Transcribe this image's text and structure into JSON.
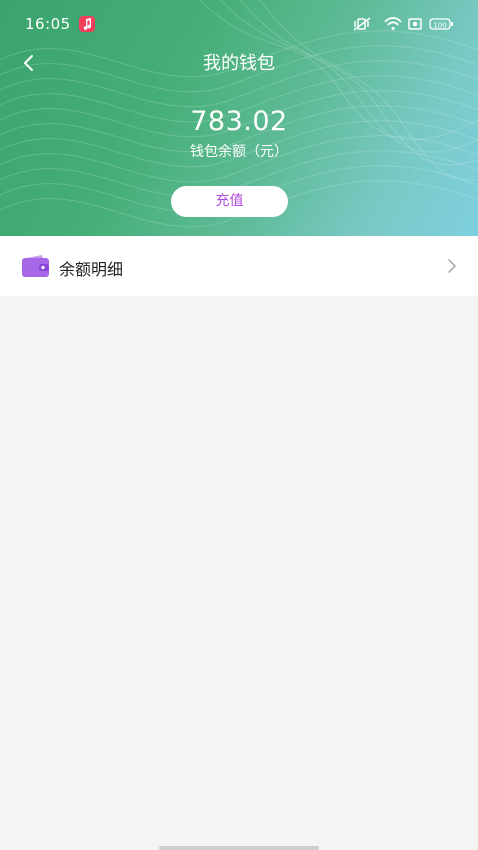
{
  "status_bar": {
    "time": "16:05",
    "battery": "100"
  },
  "nav": {
    "title": "我的钱包"
  },
  "wallet": {
    "balance": "783.02",
    "balance_label": "钱包余额（元）",
    "recharge_label": "充值"
  },
  "rows": [
    {
      "label": "余额明细",
      "icon": "wallet-icon"
    }
  ],
  "colors": {
    "header_start": "#3aa46c",
    "header_end": "#7fd0e0",
    "accent": "#b14bd9",
    "background": "#f4f4f4"
  }
}
